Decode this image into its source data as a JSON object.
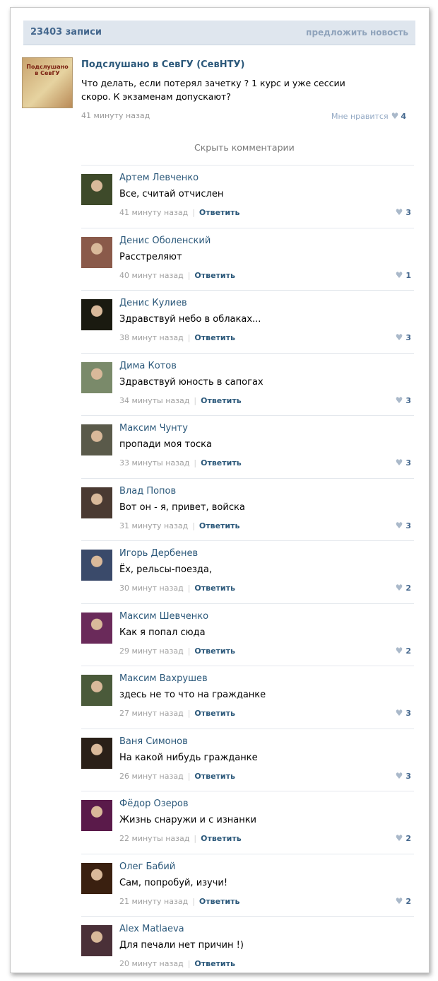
{
  "header": {
    "count_label": "23403 записи",
    "suggest_label": "предложить новость"
  },
  "post": {
    "avatar_text_top": "Подслушано в СевГУ",
    "avatar_text_bottom": "",
    "author": "Подслушано в СевГУ (СевНТУ)",
    "text": "Что делать, если потерял зачетку ? 1 курс и уже сессии скоро. К экзаменам допускают?",
    "time": "41 минуту назад",
    "like_label": "Мне нравится",
    "like_count": "4"
  },
  "hide_comments_label": "Скрыть комментарии",
  "reply_label": "Ответить",
  "comments": [
    {
      "name": "Артем Левченко",
      "text": "Все, считай отчислен",
      "time": "41 минуту назад",
      "likes": "3",
      "avatar_color": "#3e4a2a"
    },
    {
      "name": "Денис Оболенский",
      "text": "Расстреляют",
      "time": "40 минут назад",
      "likes": "1",
      "avatar_color": "#8a5a4a"
    },
    {
      "name": "Денис Кулиев",
      "text": "Здравствуй небо в облаках...",
      "time": "38 минут назад",
      "likes": "3",
      "avatar_color": "#1a1a10"
    },
    {
      "name": "Дима Котов",
      "text": "Здравствуй юность в сапогах",
      "time": "34 минуты назад",
      "likes": "3",
      "avatar_color": "#7a8a6a"
    },
    {
      "name": "Максим Чунту",
      "text": "пропади моя тоска",
      "time": "33 минуты назад",
      "likes": "3",
      "avatar_color": "#5a5a4a"
    },
    {
      "name": "Влад Попов",
      "text": "Вот он - я, привет, войска",
      "time": "31 минуту назад",
      "likes": "3",
      "avatar_color": "#4a3a32"
    },
    {
      "name": "Игорь Дербенев",
      "text": "Ёх, рельсы-поезда,",
      "time": "30 минут назад",
      "likes": "2",
      "avatar_color": "#3a4a6a"
    },
    {
      "name": "Максим Шевченко",
      "text": "Как я попал сюда",
      "time": "29 минут назад",
      "likes": "2",
      "avatar_color": "#6a2a5a"
    },
    {
      "name": "Максим Вахрушев",
      "text": "здесь не то что на гражданке",
      "time": "27 минут назад",
      "likes": "3",
      "avatar_color": "#4a5a3a"
    },
    {
      "name": "Ваня Симонов",
      "text": "На какой нибудь гражданке",
      "time": "26 минут назад",
      "likes": "3",
      "avatar_color": "#2a2018"
    },
    {
      "name": "Фёдор Озеров",
      "text": "Жизнь снаружи и с изнанки",
      "time": "22 минуты назад",
      "likes": "2",
      "avatar_color": "#5a1a4a"
    },
    {
      "name": "Олег Бабий",
      "text": "Сам, попробуй, изучи!",
      "time": "21 минуту назад",
      "likes": "2",
      "avatar_color": "#3a2010"
    },
    {
      "name": "Alex Matlaeva",
      "text": "Для печали нет причин !)",
      "time": "20 минут назад",
      "likes": "",
      "avatar_color": "#4a3038"
    }
  ]
}
